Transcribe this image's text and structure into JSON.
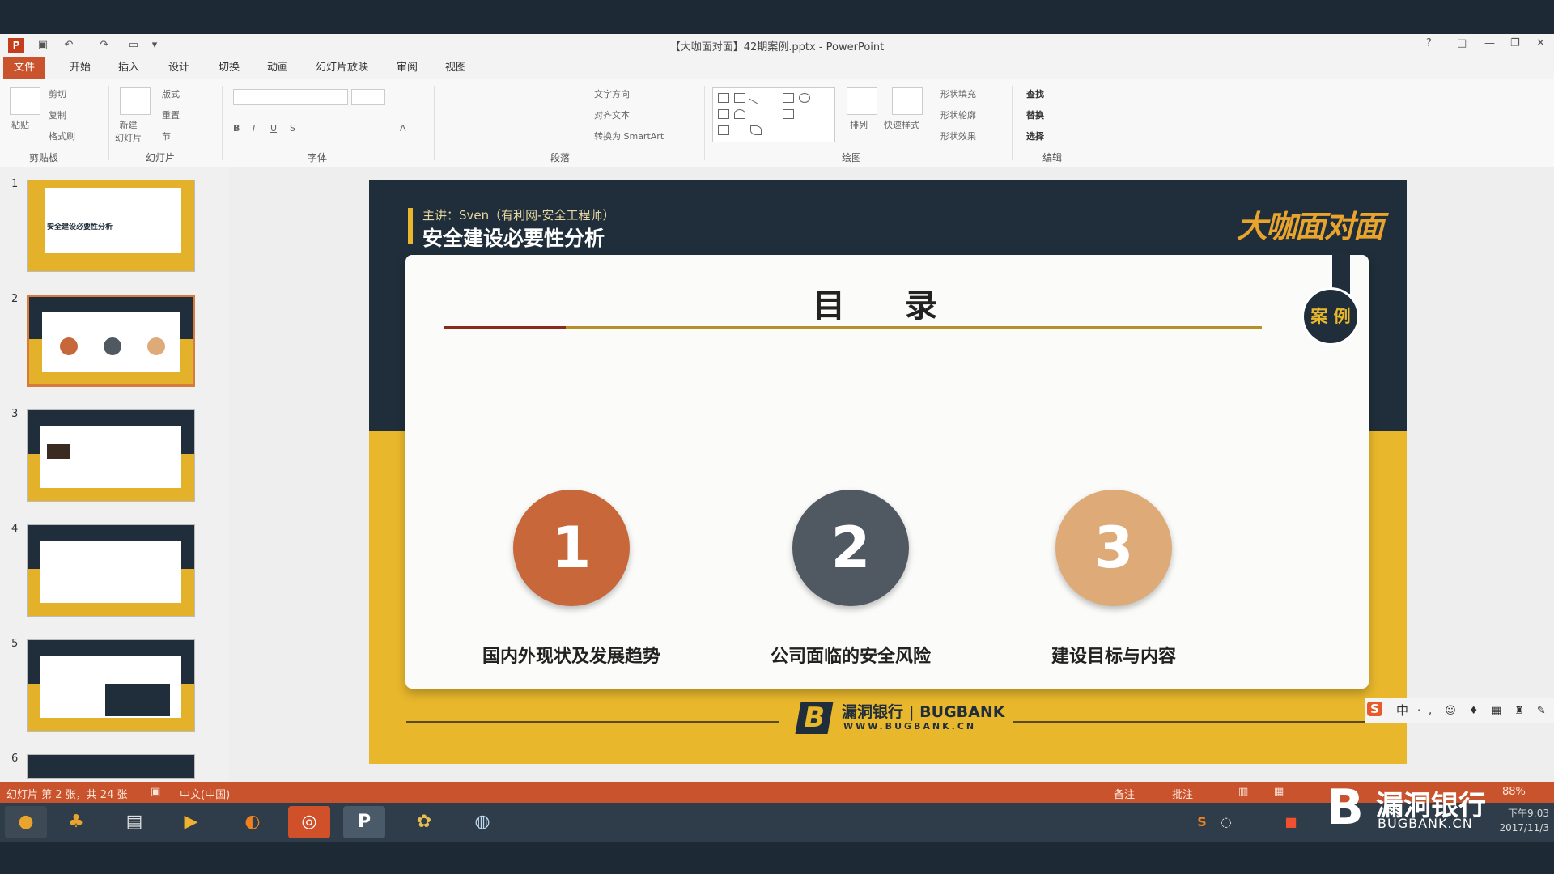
{
  "window": {
    "title": "【大咖面对面】42期案例.pptx - PowerPoint",
    "controls": [
      "?",
      "□",
      "—",
      "❐",
      "✕"
    ]
  },
  "tabs": [
    "文件",
    "开始",
    "插入",
    "设计",
    "切换",
    "动画",
    "幻灯片放映",
    "审阅",
    "视图"
  ],
  "ribbon": {
    "clipboard": {
      "paste": "粘贴",
      "cut": "剪切",
      "copy": "复制",
      "format_painter": "格式刷",
      "label": "剪贴板"
    },
    "slides": {
      "new_slide": "新建\n幻灯片",
      "layout": "版式",
      "reset": "重置",
      "section": "节",
      "label": "幻灯片"
    },
    "font": {
      "label": "字体"
    },
    "paragraph": {
      "text_direction": "文字方向",
      "align_text": "对齐文本",
      "smartart": "转换为 SmartArt",
      "label": "段落"
    },
    "drawing": {
      "arrange": "排列",
      "quick_styles": "快速样式",
      "fill": "形状填充",
      "outline": "形状轮廓",
      "effects": "形状效果",
      "label": "绘图"
    },
    "editing": {
      "find": "查找",
      "replace": "替换",
      "select": "选择",
      "label": "编辑"
    }
  },
  "thumbnails": [
    "1",
    "2",
    "3",
    "4",
    "5",
    "6"
  ],
  "thumb1_text": "安全建设必要性分析",
  "slide": {
    "presenter": "主讲：Sven（有利网-安全工程师）",
    "title": "安全建设必要性分析",
    "brand": "大咖面对面",
    "toc_title": "目 录",
    "badge": "案 例",
    "items": [
      {
        "num": "1",
        "label": "国内外现状及发展趋势",
        "color": "#c7673a"
      },
      {
        "num": "2",
        "label": "公司面临的安全风险",
        "color": "#505962"
      },
      {
        "num": "3",
        "label": "建设目标与内容",
        "color": "#deab78"
      }
    ],
    "footer_brand": "漏洞银行 | BUGBANK",
    "footer_url": "WWW.BUGBANK.CN"
  },
  "ime": {
    "logo": "S",
    "lang": "中",
    "items": "ㆍ, ☺ ♦ ▦ ♜ ✎"
  },
  "status": {
    "slide_info": "幻灯片 第 2 张，共 24 张",
    "language": "中文(中国)",
    "notes": "备注",
    "comments": "批注",
    "zoom": "88%"
  },
  "watermark": {
    "logo": "B",
    "name": "漏洞银行",
    "url": "BUGBANK.CN"
  },
  "clock": {
    "time": "下午9:03",
    "date": "2017/11/3"
  },
  "colors": {
    "accent": "#c9532c",
    "slide_dark": "#1f2e3a",
    "slide_yellow": "#e8b72c"
  }
}
